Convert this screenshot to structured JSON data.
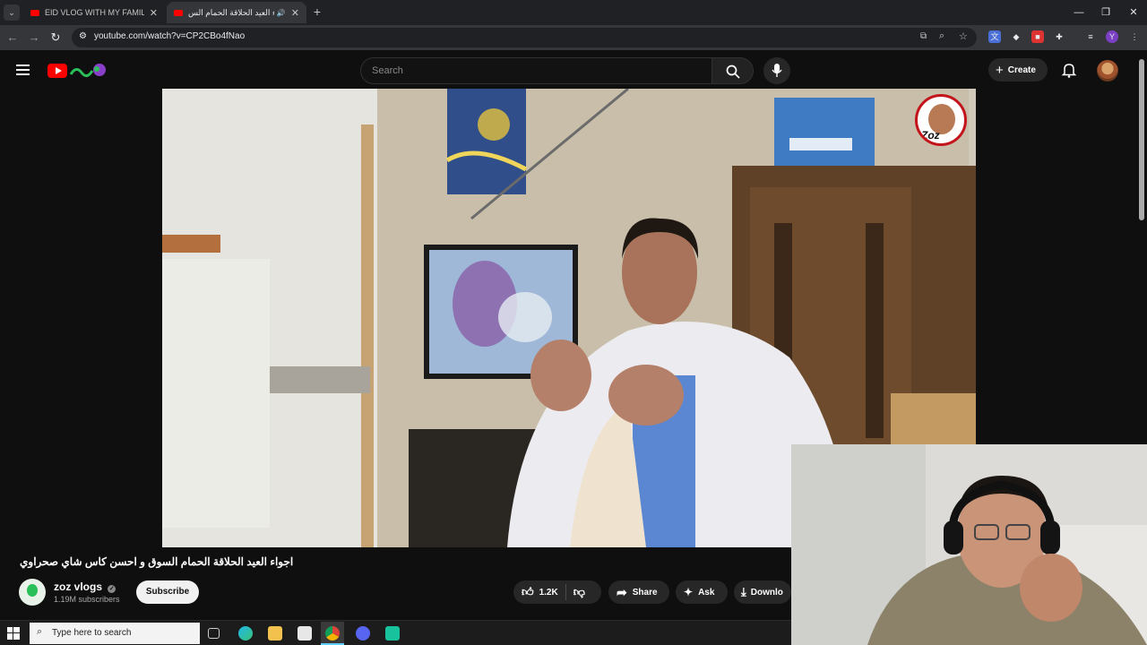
{
  "browser": {
    "tabs": [
      {
        "title": "EID VLOG WITH MY FAMILY I 😊"
      },
      {
        "title": "اجواء العيد الحلاقة الحمام الس..."
      }
    ],
    "url": "youtube.com/watch?v=CP2CBo4fNao"
  },
  "header": {
    "search_placeholder": "Search",
    "create_label": "Create"
  },
  "video": {
    "title": "اجواء العيد الحلاقة الحمام السوق و احسن كاس شاي صحراوي",
    "channel_name": "zoz vlogs",
    "subscribers": "1.19M subscribers",
    "subscribe_label": "Subscribe",
    "like_count": "1.2K",
    "share_label": "Share",
    "ask_label": "Ask",
    "download_label": "Downlo",
    "watermark_text": "Zoz"
  },
  "taskbar": {
    "search_placeholder": "Type here to search"
  },
  "colors": {
    "youtube_red": "#ff0000",
    "background": "#0f0f0f",
    "button_bg": "#272727"
  }
}
